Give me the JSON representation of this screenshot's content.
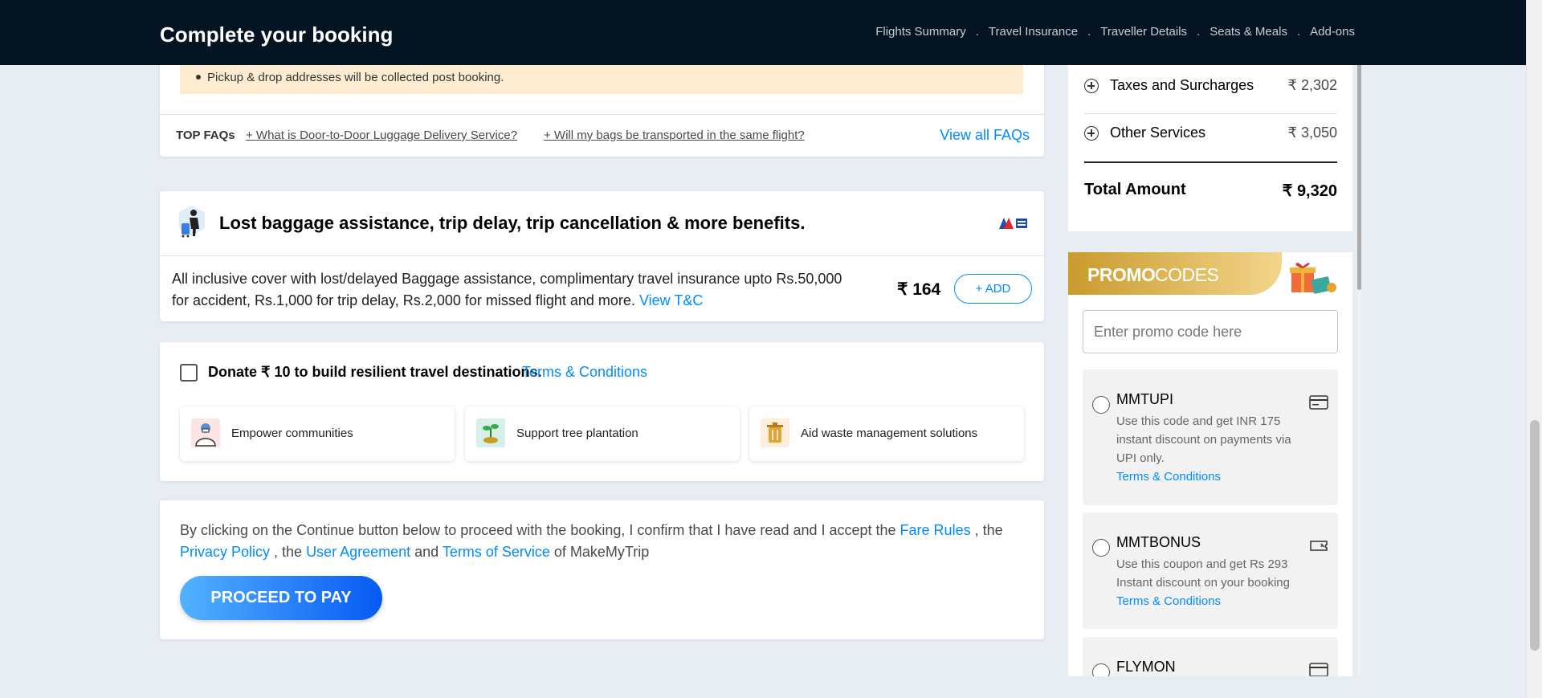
{
  "header": {
    "title": "Complete your booking",
    "nav": [
      "Flights Summary",
      "Travel Insurance",
      "Traveller Details",
      "Seats & Meals",
      "Add-ons"
    ]
  },
  "faq": {
    "notice": "Pickup & drop addresses will be collected post booking.",
    "label": "TOP FAQs",
    "questions": [
      "+ What is Door-to-Door Luggage Delivery Service?",
      "+ Will my bags be transported in the same flight?"
    ],
    "view_all": "View all FAQs"
  },
  "insurance": {
    "headline": "Lost baggage assistance, trip delay, trip cancellation & more benefits.",
    "description": "All inclusive cover with lost/delayed Baggage assistance, complimentary travel insurance upto Rs.50,000 for accident, Rs.1,000 for trip delay, Rs.2,000 for missed flight and more.",
    "tc_link": "View T&C",
    "price": "₹ 164",
    "add_label": "+ ADD"
  },
  "donate": {
    "text": "Donate ₹ 10 to build resilient travel destinations.",
    "tc": "Terms & Conditions",
    "options": [
      "Empower communities",
      "Support tree plantation",
      "Aid waste management solutions"
    ]
  },
  "consent": {
    "p1": "By clicking on the Continue button below to proceed with the booking, I confirm that I have read and I accept the ",
    "fare_rules": "Fare Rules",
    "sep1": " , the ",
    "privacy": "Privacy Policy",
    "sep2": " , the ",
    "user_agreement": "User Agreement",
    "sep3": " and ",
    "tos": "Terms of Service",
    "p2": " of MakeMyTrip",
    "button": "PROCEED TO PAY"
  },
  "fare": {
    "rows": [
      {
        "label": "Taxes and Surcharges",
        "amount": "₹ 2,302"
      },
      {
        "label": "Other Services",
        "amount": "₹ 3,050"
      }
    ],
    "total_label": "Total Amount",
    "total_amount": "₹ 9,320"
  },
  "promo": {
    "title_bold": "PROMO",
    "title_light": "CODES",
    "placeholder": "Enter promo code here",
    "items": [
      {
        "code": "MMTUPI",
        "desc": "Use this code and get INR 175 instant discount on payments via UPI only.",
        "tc": "Terms & Conditions",
        "icon": "card-icon"
      },
      {
        "code": "MMTBONUS",
        "desc": "Use this coupon and get Rs 293 Instant discount on your booking",
        "tc": "Terms & Conditions",
        "icon": "ticket-icon"
      },
      {
        "code": "FLYMON",
        "desc": "",
        "tc": "",
        "icon": "card-icon"
      }
    ]
  },
  "colors": {
    "header_bg": "#051423",
    "link": "#008cff",
    "page_bg": "#e7edf3",
    "notice_bg": "#ffedd1"
  }
}
